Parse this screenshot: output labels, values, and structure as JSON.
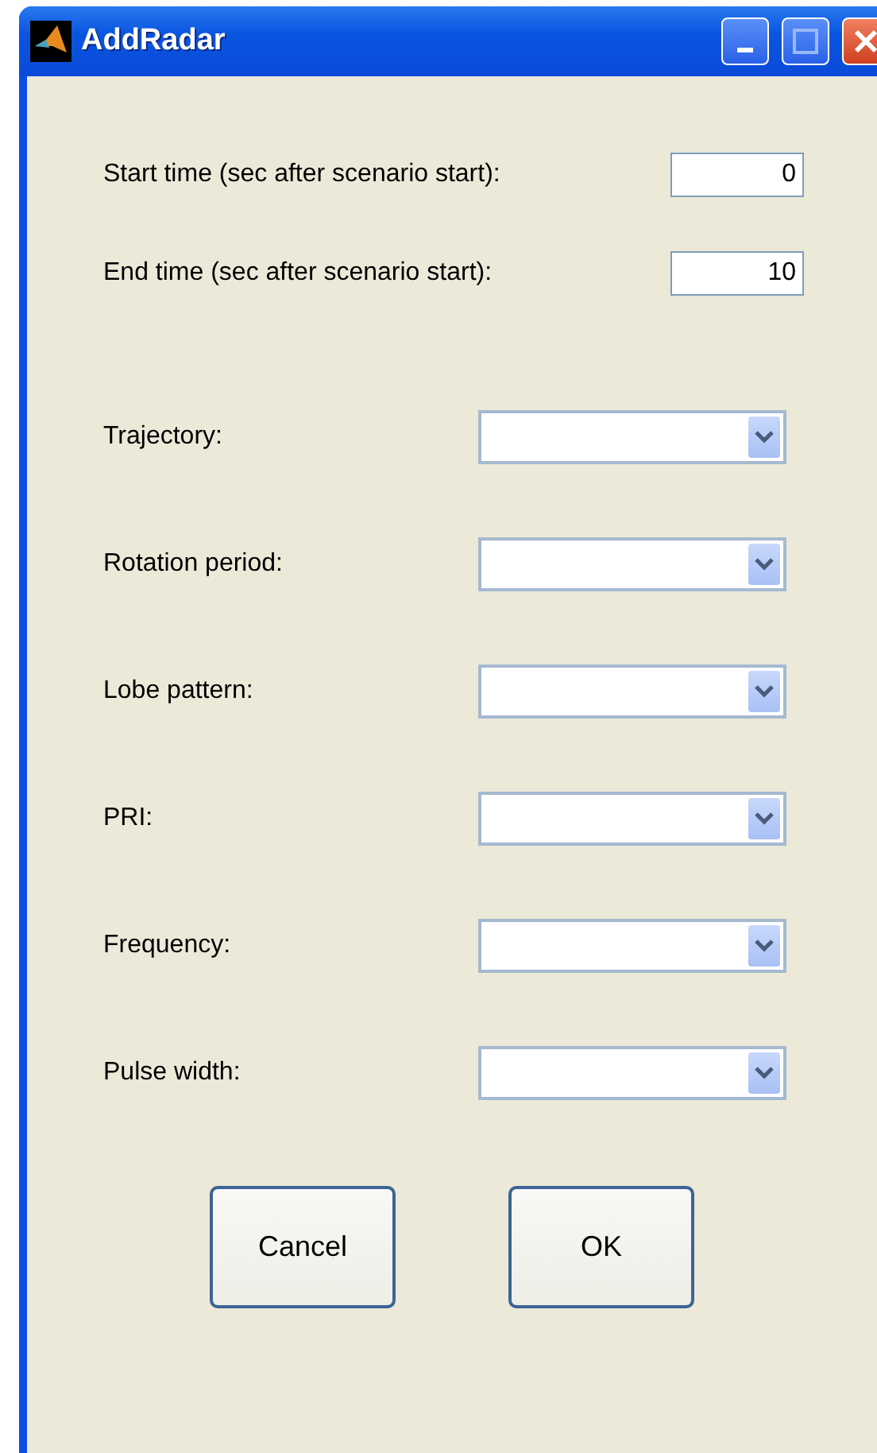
{
  "window": {
    "title": "AddRadar"
  },
  "time_fields": [
    {
      "label": "Start time (sec after scenario start):",
      "value": "0"
    },
    {
      "label": "End time (sec after scenario start):",
      "value": "10"
    }
  ],
  "dropdowns": [
    {
      "label": "Trajectory:"
    },
    {
      "label": "Rotation period:"
    },
    {
      "label": "Lobe pattern:"
    },
    {
      "label": "PRI:"
    },
    {
      "label": "Frequency:"
    },
    {
      "label": "Pulse width:"
    }
  ],
  "buttons": [
    "Cancel",
    "OK"
  ]
}
